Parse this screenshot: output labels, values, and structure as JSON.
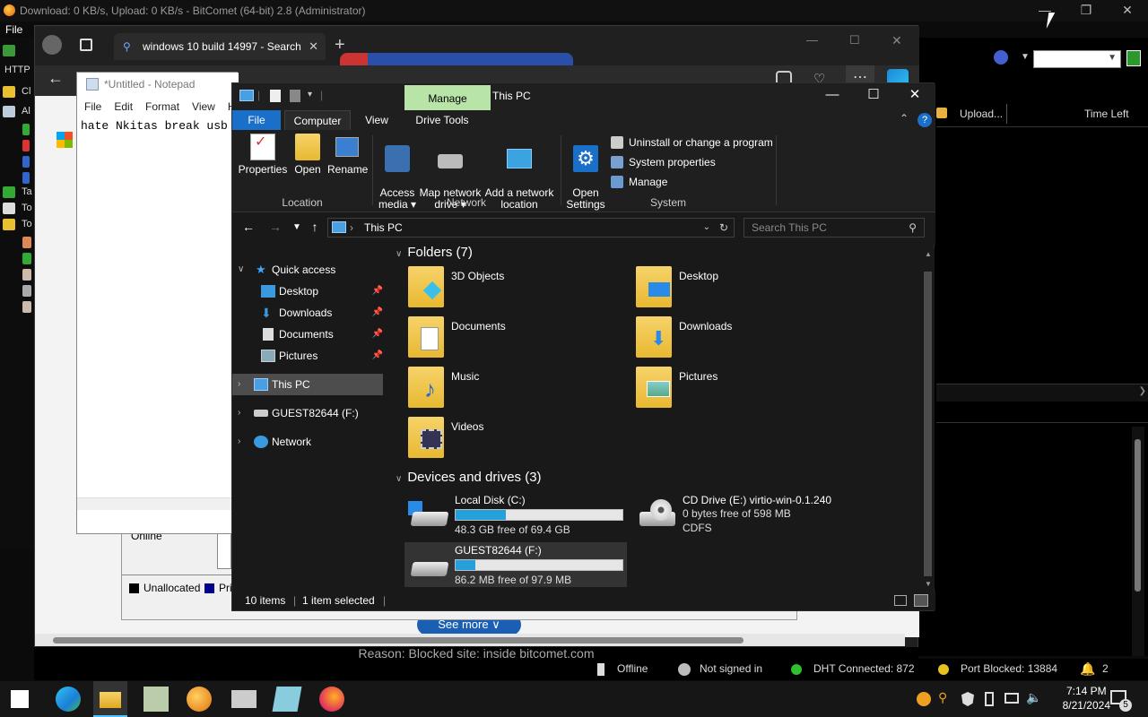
{
  "bitcomet": {
    "title": "Download: 0 KB/s, Upload: 0 KB/s - BitComet (64-bit) 2.8 (Administrator)",
    "menu_file": "File",
    "left_http": "HTTP",
    "left_items": [
      "Cl",
      "Al",
      "Ta",
      "To",
      "To"
    ],
    "col_upload": "Upload...",
    "col_time_left": "Time Left",
    "status_offline": "Offline",
    "status_signin": "Not signed in",
    "status_dht": "DHT Connected: 872",
    "status_port": "Port Blocked: 13884",
    "status_notif": "2",
    "reason_text": "Reason: Blocked site: inside bitcomet.com",
    "see_more": "See more"
  },
  "edge": {
    "tab_title": "windows 10 build 14997 - Search",
    "tab_close": "✕",
    "new_tab": "+"
  },
  "disk_mgmt": {
    "online": "Online",
    "legend_unallocated": "Unallocated",
    "legend_primary": "Pri"
  },
  "notepad": {
    "title": "*Untitled - Notepad",
    "menu": [
      "File",
      "Edit",
      "Format",
      "View",
      "H"
    ],
    "content": "hate Nkitas break usb"
  },
  "explorer": {
    "manage_tab": "Manage",
    "window_title": "This PC",
    "ribbon_tabs": [
      "File",
      "Computer",
      "View",
      "Drive Tools"
    ],
    "ribbon_buttons": {
      "properties": "Properties",
      "open": "Open",
      "rename": "Rename",
      "access_media": "Access\nmedia ▾",
      "map_network": "Map network\ndrive ▾",
      "add_network": "Add a network\nlocation",
      "open_settings": "Open\nSettings"
    },
    "ribbon_small": [
      "Uninstall or change a program",
      "System properties",
      "Manage"
    ],
    "ribbon_groups": [
      "Location",
      "Network",
      "System"
    ],
    "address": "This PC",
    "search_placeholder": "Search This PC",
    "tree": {
      "quick_access": "Quick access",
      "desktop": "Desktop",
      "downloads": "Downloads",
      "documents": "Documents",
      "pictures": "Pictures",
      "this_pc": "This PC",
      "guest_drive": "GUEST82644 (F:)",
      "network": "Network"
    },
    "folders_header": "Folders (7)",
    "folders": [
      "3D Objects",
      "Desktop",
      "Documents",
      "Downloads",
      "Music",
      "Pictures",
      "Videos"
    ],
    "devices_header": "Devices and drives (3)",
    "drives": [
      {
        "name": "Local Disk (C:)",
        "space": "48.3 GB free of 69.4 GB",
        "used_fraction": 0.3
      },
      {
        "name": "CD Drive (E:) virtio-win-0.1.240",
        "line2": "0 bytes free of 598 MB",
        "line3": "CDFS"
      },
      {
        "name": "GUEST82644 (F:)",
        "space": "86.2 MB free of 97.9 MB",
        "used_fraction": 0.12
      }
    ],
    "status_items": "10 items",
    "status_selected": "1 item selected"
  },
  "taskbar": {
    "time": "7:14 PM",
    "date": "8/21/2024",
    "notif_count": "5"
  },
  "colors": {
    "accent_blue": "#26a0da",
    "manage_green": "#b8e4a8",
    "file_tab_blue": "#1a6fc9"
  }
}
